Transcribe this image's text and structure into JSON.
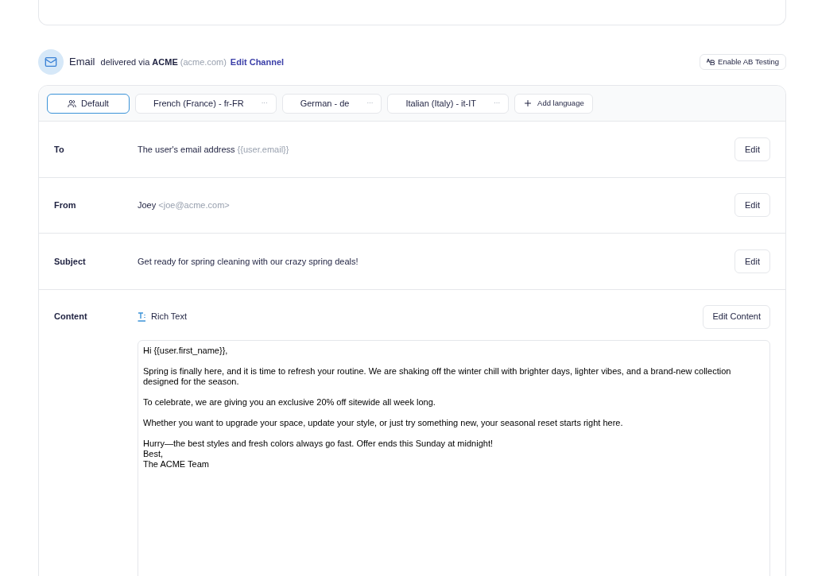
{
  "channel": {
    "name": "Email",
    "via": "delivered via",
    "provider": "ACME",
    "domain": "(acme.com)",
    "edit_link": "Edit Channel",
    "ab_button": "Enable AB Testing"
  },
  "tabs": [
    {
      "label": "Default",
      "selected": true,
      "kind": "default"
    },
    {
      "label": "French (France) - fr-FR",
      "selected": false,
      "kind": "language",
      "menu": "···"
    },
    {
      "label": "German - de",
      "selected": false,
      "kind": "language",
      "menu": "···"
    },
    {
      "label": "Italian (Italy) - it-IT",
      "selected": false,
      "kind": "language",
      "menu": "···"
    },
    {
      "label": "Add language",
      "selected": false,
      "kind": "add"
    }
  ],
  "fields": [
    {
      "label": "To",
      "value": "The user's email address",
      "hint": "{{user.email}}",
      "button": "Edit"
    },
    {
      "label": "From",
      "value": "Joey",
      "hint": "<joe@acme.com>",
      "button": "Edit"
    },
    {
      "label": "Subject",
      "value": "Get ready for spring cleaning with our crazy spring deals!",
      "button": "Edit"
    }
  ],
  "content": {
    "label": "Content",
    "format": "Rich Text",
    "button": "Edit Content",
    "body": [
      [
        "Hi {{user.first_name}},"
      ],
      [
        "Spring is finally here, and it is time to refresh your routine. We are shaking off the winter chill with brighter days, lighter vibes, and a brand-new collection designed for the season."
      ],
      [
        "To celebrate, we are giving you an exclusive 20% off sitewide all week long."
      ],
      [
        "Whether you want to upgrade your space, update your style, or just try something new, your seasonal reset starts right here."
      ],
      [
        "Hurry—the best styles and fresh colors always go fast. Offer ends this Sunday at midnight!",
        "Best,",
        "The ACME Team"
      ]
    ]
  }
}
